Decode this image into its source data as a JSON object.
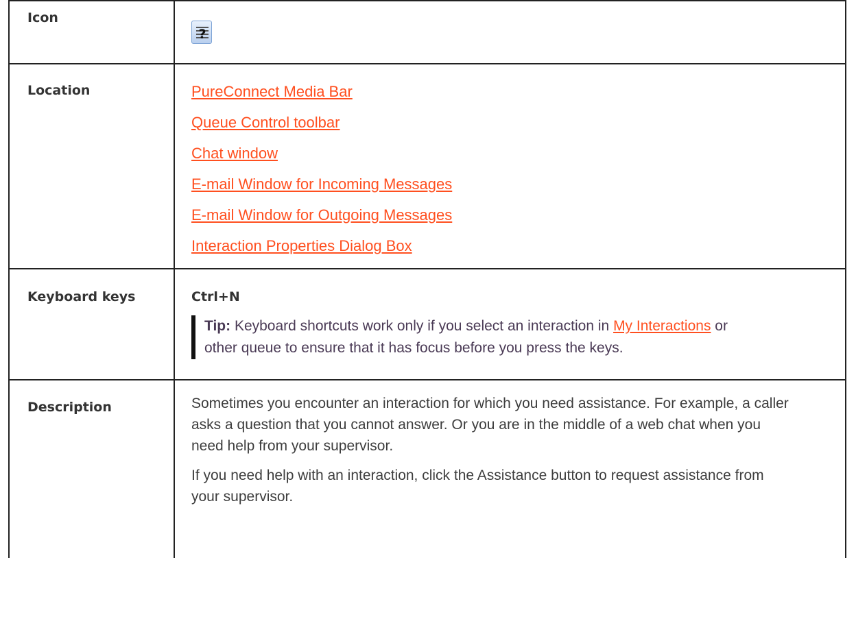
{
  "table": {
    "icon_row": {
      "label": "Icon",
      "icon": "assistance-icon"
    },
    "location_row": {
      "label": "Location",
      "links": [
        "PureConnect Media Bar",
        "Queue Control toolbar",
        "Chat window",
        "E-mail Window for Incoming Messages",
        "E-mail Window for Outgoing Messages",
        "Interaction Properties Dialog Box"
      ]
    },
    "keys_row": {
      "label": "Keyboard keys",
      "shortcut": "Ctrl+N",
      "tip_label": "Tip:",
      "tip_text_before": " Keyboard shortcuts work only if you select an interaction in ",
      "tip_link": "My Interactions",
      "tip_text_after": " or other queue to ensure that it has focus before you press the keys."
    },
    "description_row": {
      "label": "Description",
      "paragraphs": [
        "Sometimes you encounter an interaction for which you need assistance. For example, a caller asks a question that you cannot answer. Or you are in the middle of a web chat when you need help from your supervisor.",
        "If you need help with an interaction, click the Assistance button to request assistance from your supervisor."
      ]
    }
  },
  "colors": {
    "link": "#ff4f1f",
    "border": "#222222"
  }
}
